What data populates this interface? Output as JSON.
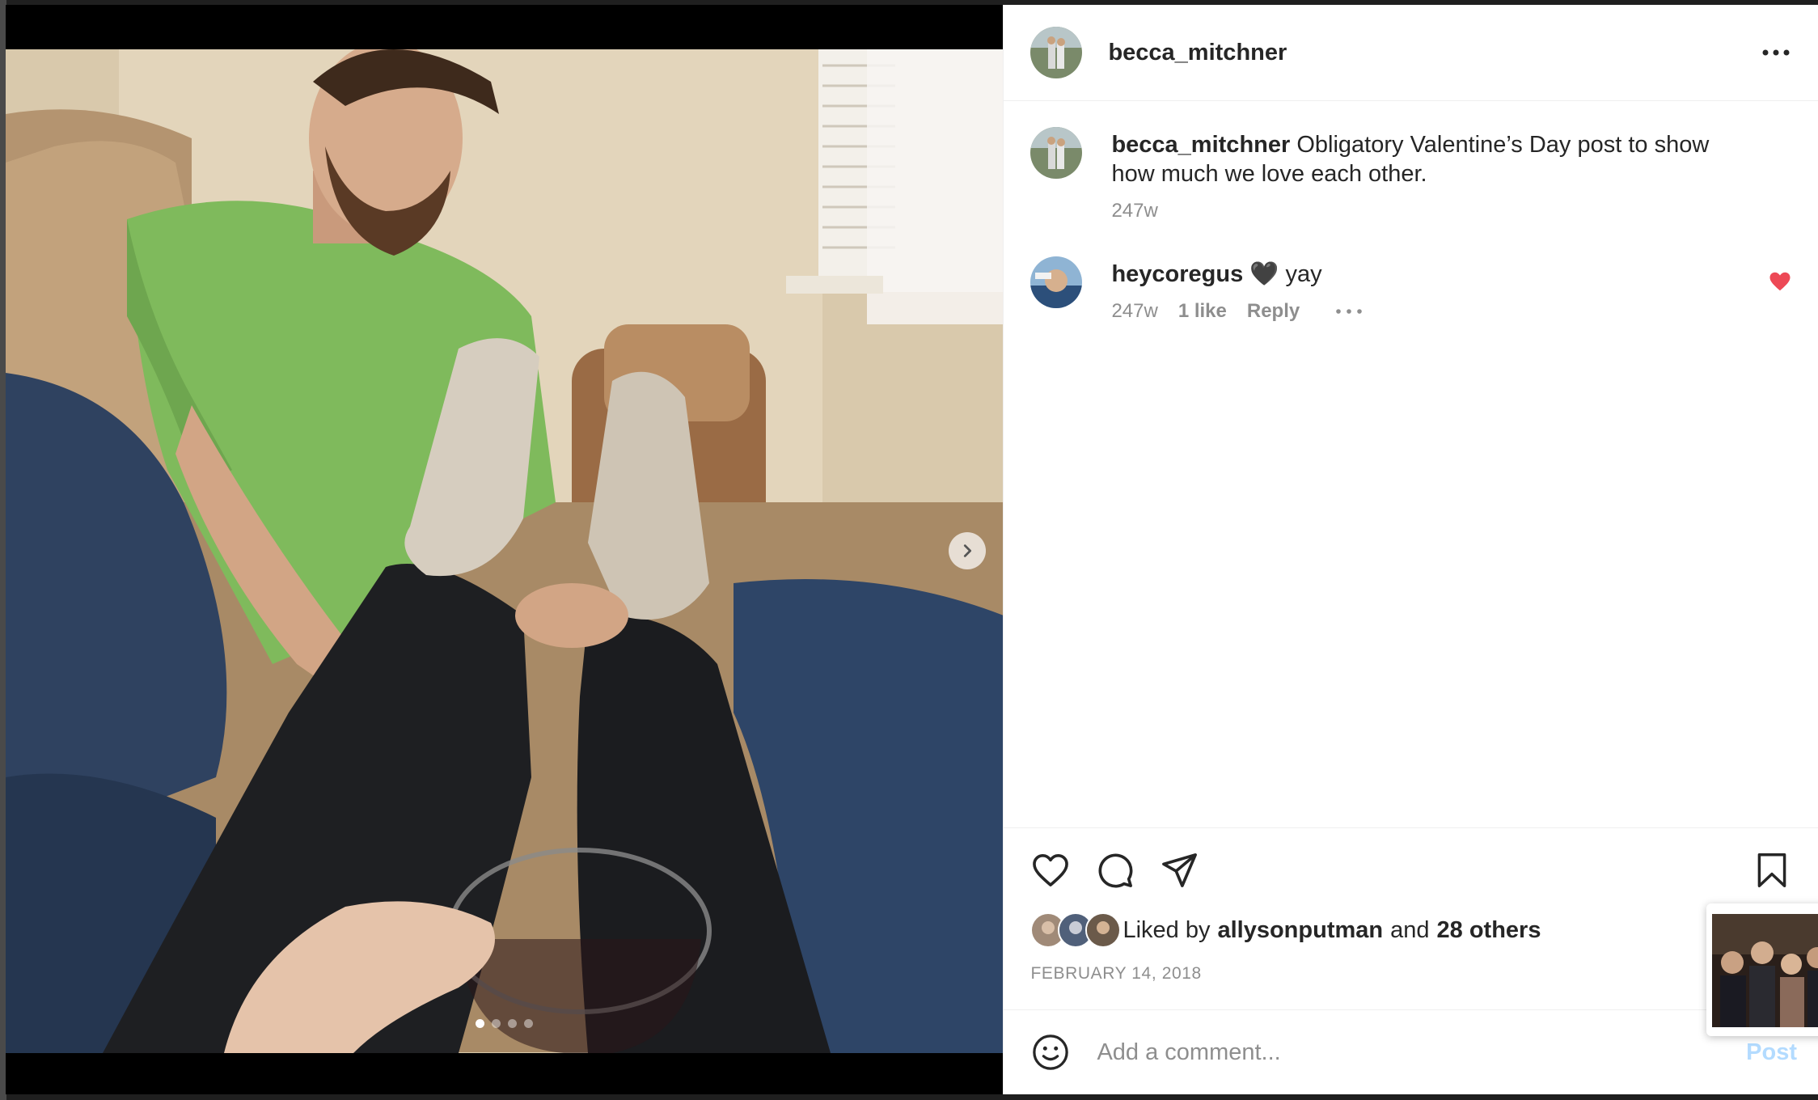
{
  "post": {
    "username": "becca_mitchner",
    "caption_username": "becca_mitchner",
    "caption_text": "Obligatory Valentine’s Day post to show how much we love each other.",
    "caption_age": "247w",
    "carousel": {
      "total": 4,
      "current": 1
    }
  },
  "comments": [
    {
      "username": "heycoregus",
      "text": "🖤 yay",
      "age": "247w",
      "likes": "1 like",
      "reply_label": "Reply",
      "liked": true
    }
  ],
  "likes": {
    "prefix": "Liked by",
    "first_liker": "allysonputman",
    "conjunction": "and",
    "others": "28 others"
  },
  "date": "FEBRUARY 14, 2018",
  "add_comment": {
    "placeholder": "Add a comment...",
    "post_label": "Post"
  },
  "icons": {
    "more": "more-horizontal-icon",
    "like": "heart-icon",
    "comment": "comment-bubble-icon",
    "share": "paper-plane-icon",
    "save": "bookmark-icon",
    "emoji": "smiley-icon",
    "next": "chevron-right-icon"
  },
  "colors": {
    "liked_heart": "#ed4956",
    "post_button_disabled": "#b3dbff",
    "secondary_text": "#8e8e8e",
    "primary_text": "#262626"
  }
}
